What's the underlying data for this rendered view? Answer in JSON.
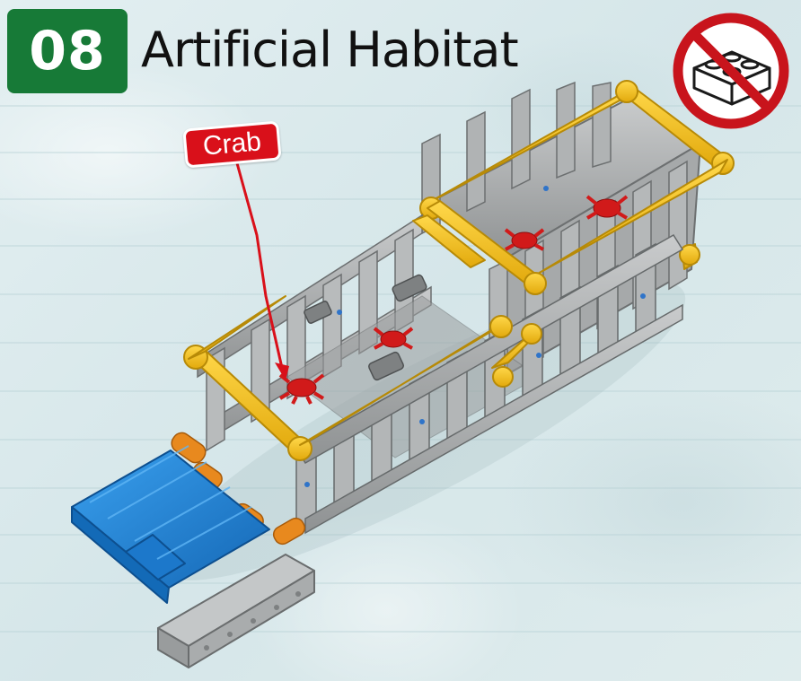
{
  "header": {
    "step_number": "08",
    "title": "Artificial Habitat"
  },
  "callout": {
    "label": "Crab"
  },
  "icons": {
    "prohibition": "no-brick-icon",
    "model": "lego-technic-habitat-model"
  },
  "colors": {
    "badge_green": "#177a37",
    "callout_red": "#d9101a",
    "prohibition_red": "#c8141c",
    "beam_yellow": "#f5c319",
    "beam_gray": "#a9acad",
    "plate_blue": "#1e82d6",
    "connector_orange": "#e8891e",
    "crab_red": "#d11a1a"
  }
}
